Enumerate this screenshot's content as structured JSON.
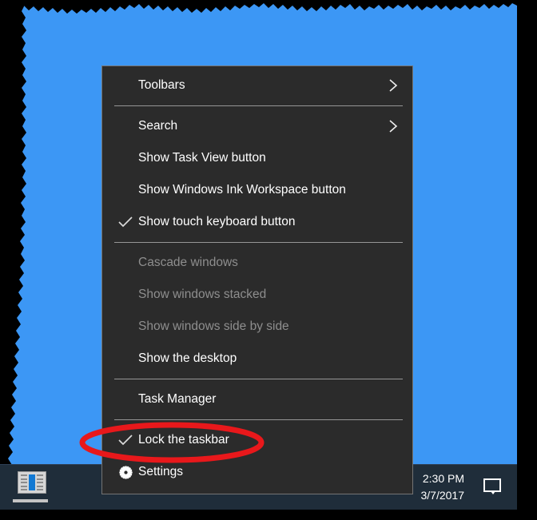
{
  "window": {
    "background_color": "#3c97f5",
    "border_color": "#000000"
  },
  "context_menu": {
    "name": "taskbar-context-menu",
    "background_color": "#2b2b2b",
    "border_color": "#747474",
    "text_color": "#ffffff",
    "disabled_text_color": "#8e8e8e",
    "separator_color": "#969696",
    "groups": [
      {
        "items": [
          {
            "label": "Toolbars",
            "icon": "none",
            "submenu": true,
            "checked": false,
            "disabled": false
          }
        ]
      },
      {
        "items": [
          {
            "label": "Search",
            "icon": "none",
            "submenu": true,
            "checked": false,
            "disabled": false
          },
          {
            "label": "Show Task View button",
            "icon": "none",
            "submenu": false,
            "checked": false,
            "disabled": false
          },
          {
            "label": "Show Windows Ink Workspace button",
            "icon": "none",
            "submenu": false,
            "checked": false,
            "disabled": false
          },
          {
            "label": "Show touch keyboard button",
            "icon": "check-icon",
            "submenu": false,
            "checked": true,
            "disabled": false
          }
        ]
      },
      {
        "items": [
          {
            "label": "Cascade windows",
            "icon": "none",
            "submenu": false,
            "checked": false,
            "disabled": true
          },
          {
            "label": "Show windows stacked",
            "icon": "none",
            "submenu": false,
            "checked": false,
            "disabled": true
          },
          {
            "label": "Show windows side by side",
            "icon": "none",
            "submenu": false,
            "checked": false,
            "disabled": true
          },
          {
            "label": "Show the desktop",
            "icon": "none",
            "submenu": false,
            "checked": false,
            "disabled": false
          }
        ]
      },
      {
        "items": [
          {
            "label": "Task Manager",
            "icon": "none",
            "submenu": false,
            "checked": false,
            "disabled": false
          }
        ]
      },
      {
        "items": [
          {
            "label": "Lock the taskbar",
            "icon": "check-icon",
            "submenu": false,
            "checked": true,
            "disabled": false
          },
          {
            "label": "Settings",
            "icon": "gear-icon",
            "submenu": false,
            "checked": false,
            "disabled": false
          }
        ]
      }
    ]
  },
  "annotation": {
    "shape": "ellipse",
    "color": "#e8181b",
    "stroke_width": 7,
    "targets_item": "Lock the taskbar"
  },
  "taskbar": {
    "background_color": "#1f2d3a",
    "app_button": {
      "icon": "news-app-icon",
      "active": true
    },
    "clock": {
      "time": "2:30 PM",
      "date": "3/7/2017"
    },
    "action_center": {
      "icon": "speech-bubble-icon"
    }
  }
}
